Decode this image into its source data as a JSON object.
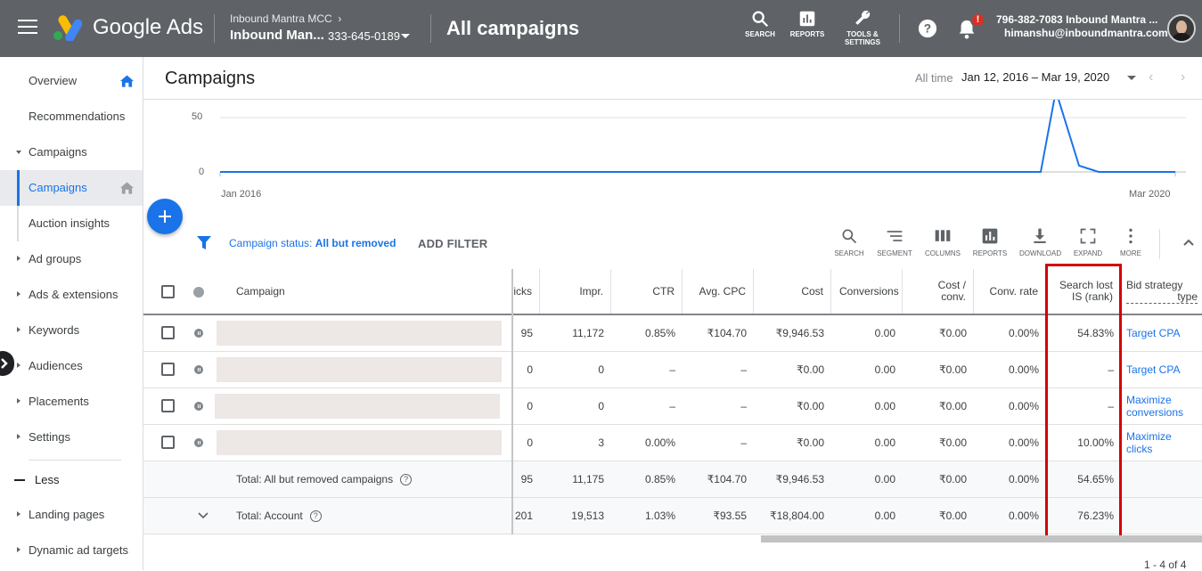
{
  "topbar": {
    "brand": "Google Ads",
    "mcc": "Inbound Mantra MCC",
    "account_name": "Inbound Man...",
    "account_id": "333-645-0189",
    "page_title": "All campaigns",
    "tools": [
      {
        "label": "SEARCH",
        "icon": "search-icon"
      },
      {
        "label": "REPORTS",
        "icon": "reports-icon"
      },
      {
        "label": "TOOLS &",
        "label2": "SETTINGS",
        "icon": "wrench-icon"
      }
    ],
    "notification_badge": "!",
    "account_line1": "796-382-7083 Inbound Mantra ...",
    "account_line2": "himanshu@inboundmantra.com"
  },
  "sidebar": {
    "items": [
      {
        "label": "Overview"
      },
      {
        "label": "Recommendations"
      },
      {
        "label": "Campaigns"
      },
      {
        "label": "Campaigns"
      },
      {
        "label": "Auction insights"
      },
      {
        "label": "Ad groups"
      },
      {
        "label": "Ads & extensions"
      },
      {
        "label": "Keywords"
      },
      {
        "label": "Audiences"
      },
      {
        "label": "Placements"
      },
      {
        "label": "Settings"
      },
      {
        "label": "Less"
      },
      {
        "label": "Landing pages"
      },
      {
        "label": "Dynamic ad targets"
      }
    ]
  },
  "header": {
    "title": "Campaigns",
    "range_label": "All time",
    "date_range": "Jan 12, 2016 – Mar 19, 2020"
  },
  "chart_data": {
    "type": "line",
    "y_ticks": [
      "50",
      "0"
    ],
    "x_labels": [
      "Jan 2016",
      "Mar 2020"
    ],
    "series_color": "#1a73e8",
    "note_values": "flat at 0 with a single spike near the end"
  },
  "filterbar": {
    "status_label": "Campaign status:",
    "status_value": "All but removed",
    "add_filter": "ADD FILTER",
    "tools": [
      "SEARCH",
      "SEGMENT",
      "COLUMNS",
      "REPORTS",
      "DOWNLOAD",
      "EXPAND",
      "MORE"
    ]
  },
  "table": {
    "headers": {
      "campaign": "Campaign",
      "clicks": "icks",
      "impr": "Impr.",
      "ctr": "CTR",
      "avg_cpc": "Avg. CPC",
      "cost": "Cost",
      "conversions": "Conversions",
      "cost_conv_1": "Cost /",
      "cost_conv_2": "conv.",
      "conv_rate": "Conv. rate",
      "search_lost_1": "Search lost",
      "search_lost_2": "IS (rank)",
      "bid_1": "Bid strategy",
      "bid_2": "type"
    },
    "rows": [
      {
        "clicks": "95",
        "impr": "11,172",
        "ctr": "0.85%",
        "cpc": "₹104.70",
        "cost": "₹9,946.53",
        "conv": "0.00",
        "cost_conv": "₹0.00",
        "conv_rate": "0.00%",
        "lost": "54.83%",
        "bid": "Target CPA",
        "bid2": ""
      },
      {
        "clicks": "0",
        "impr": "0",
        "ctr": "–",
        "cpc": "–",
        "cost": "₹0.00",
        "conv": "0.00",
        "cost_conv": "₹0.00",
        "conv_rate": "0.00%",
        "lost": "–",
        "bid": "Target CPA",
        "bid2": ""
      },
      {
        "clicks": "0",
        "impr": "0",
        "ctr": "–",
        "cpc": "–",
        "cost": "₹0.00",
        "conv": "0.00",
        "cost_conv": "₹0.00",
        "conv_rate": "0.00%",
        "lost": "–",
        "bid": "Maximize",
        "bid2": "conversions"
      },
      {
        "clicks": "0",
        "impr": "3",
        "ctr": "0.00%",
        "cpc": "–",
        "cost": "₹0.00",
        "conv": "0.00",
        "cost_conv": "₹0.00",
        "conv_rate": "0.00%",
        "lost": "10.00%",
        "bid": "Maximize",
        "bid2": "clicks"
      }
    ],
    "totals": [
      {
        "label": "Total: All but removed campaigns",
        "clicks": "95",
        "impr": "11,175",
        "ctr": "0.85%",
        "cpc": "₹104.70",
        "cost": "₹9,946.53",
        "conv": "0.00",
        "cost_conv": "₹0.00",
        "conv_rate": "0.00%",
        "lost": "54.65%"
      },
      {
        "label": "Total: Account",
        "clicks": "201",
        "impr": "19,513",
        "ctr": "1.03%",
        "cpc": "₹93.55",
        "cost": "₹18,804.00",
        "conv": "0.00",
        "cost_conv": "₹0.00",
        "conv_rate": "0.00%",
        "lost": "76.23%"
      }
    ],
    "help_glyph": "?"
  },
  "pager": "1 - 4 of 4",
  "colors": {
    "topbar": "#5f6368",
    "accent": "#1a73e8",
    "highlight": "#d50000"
  }
}
